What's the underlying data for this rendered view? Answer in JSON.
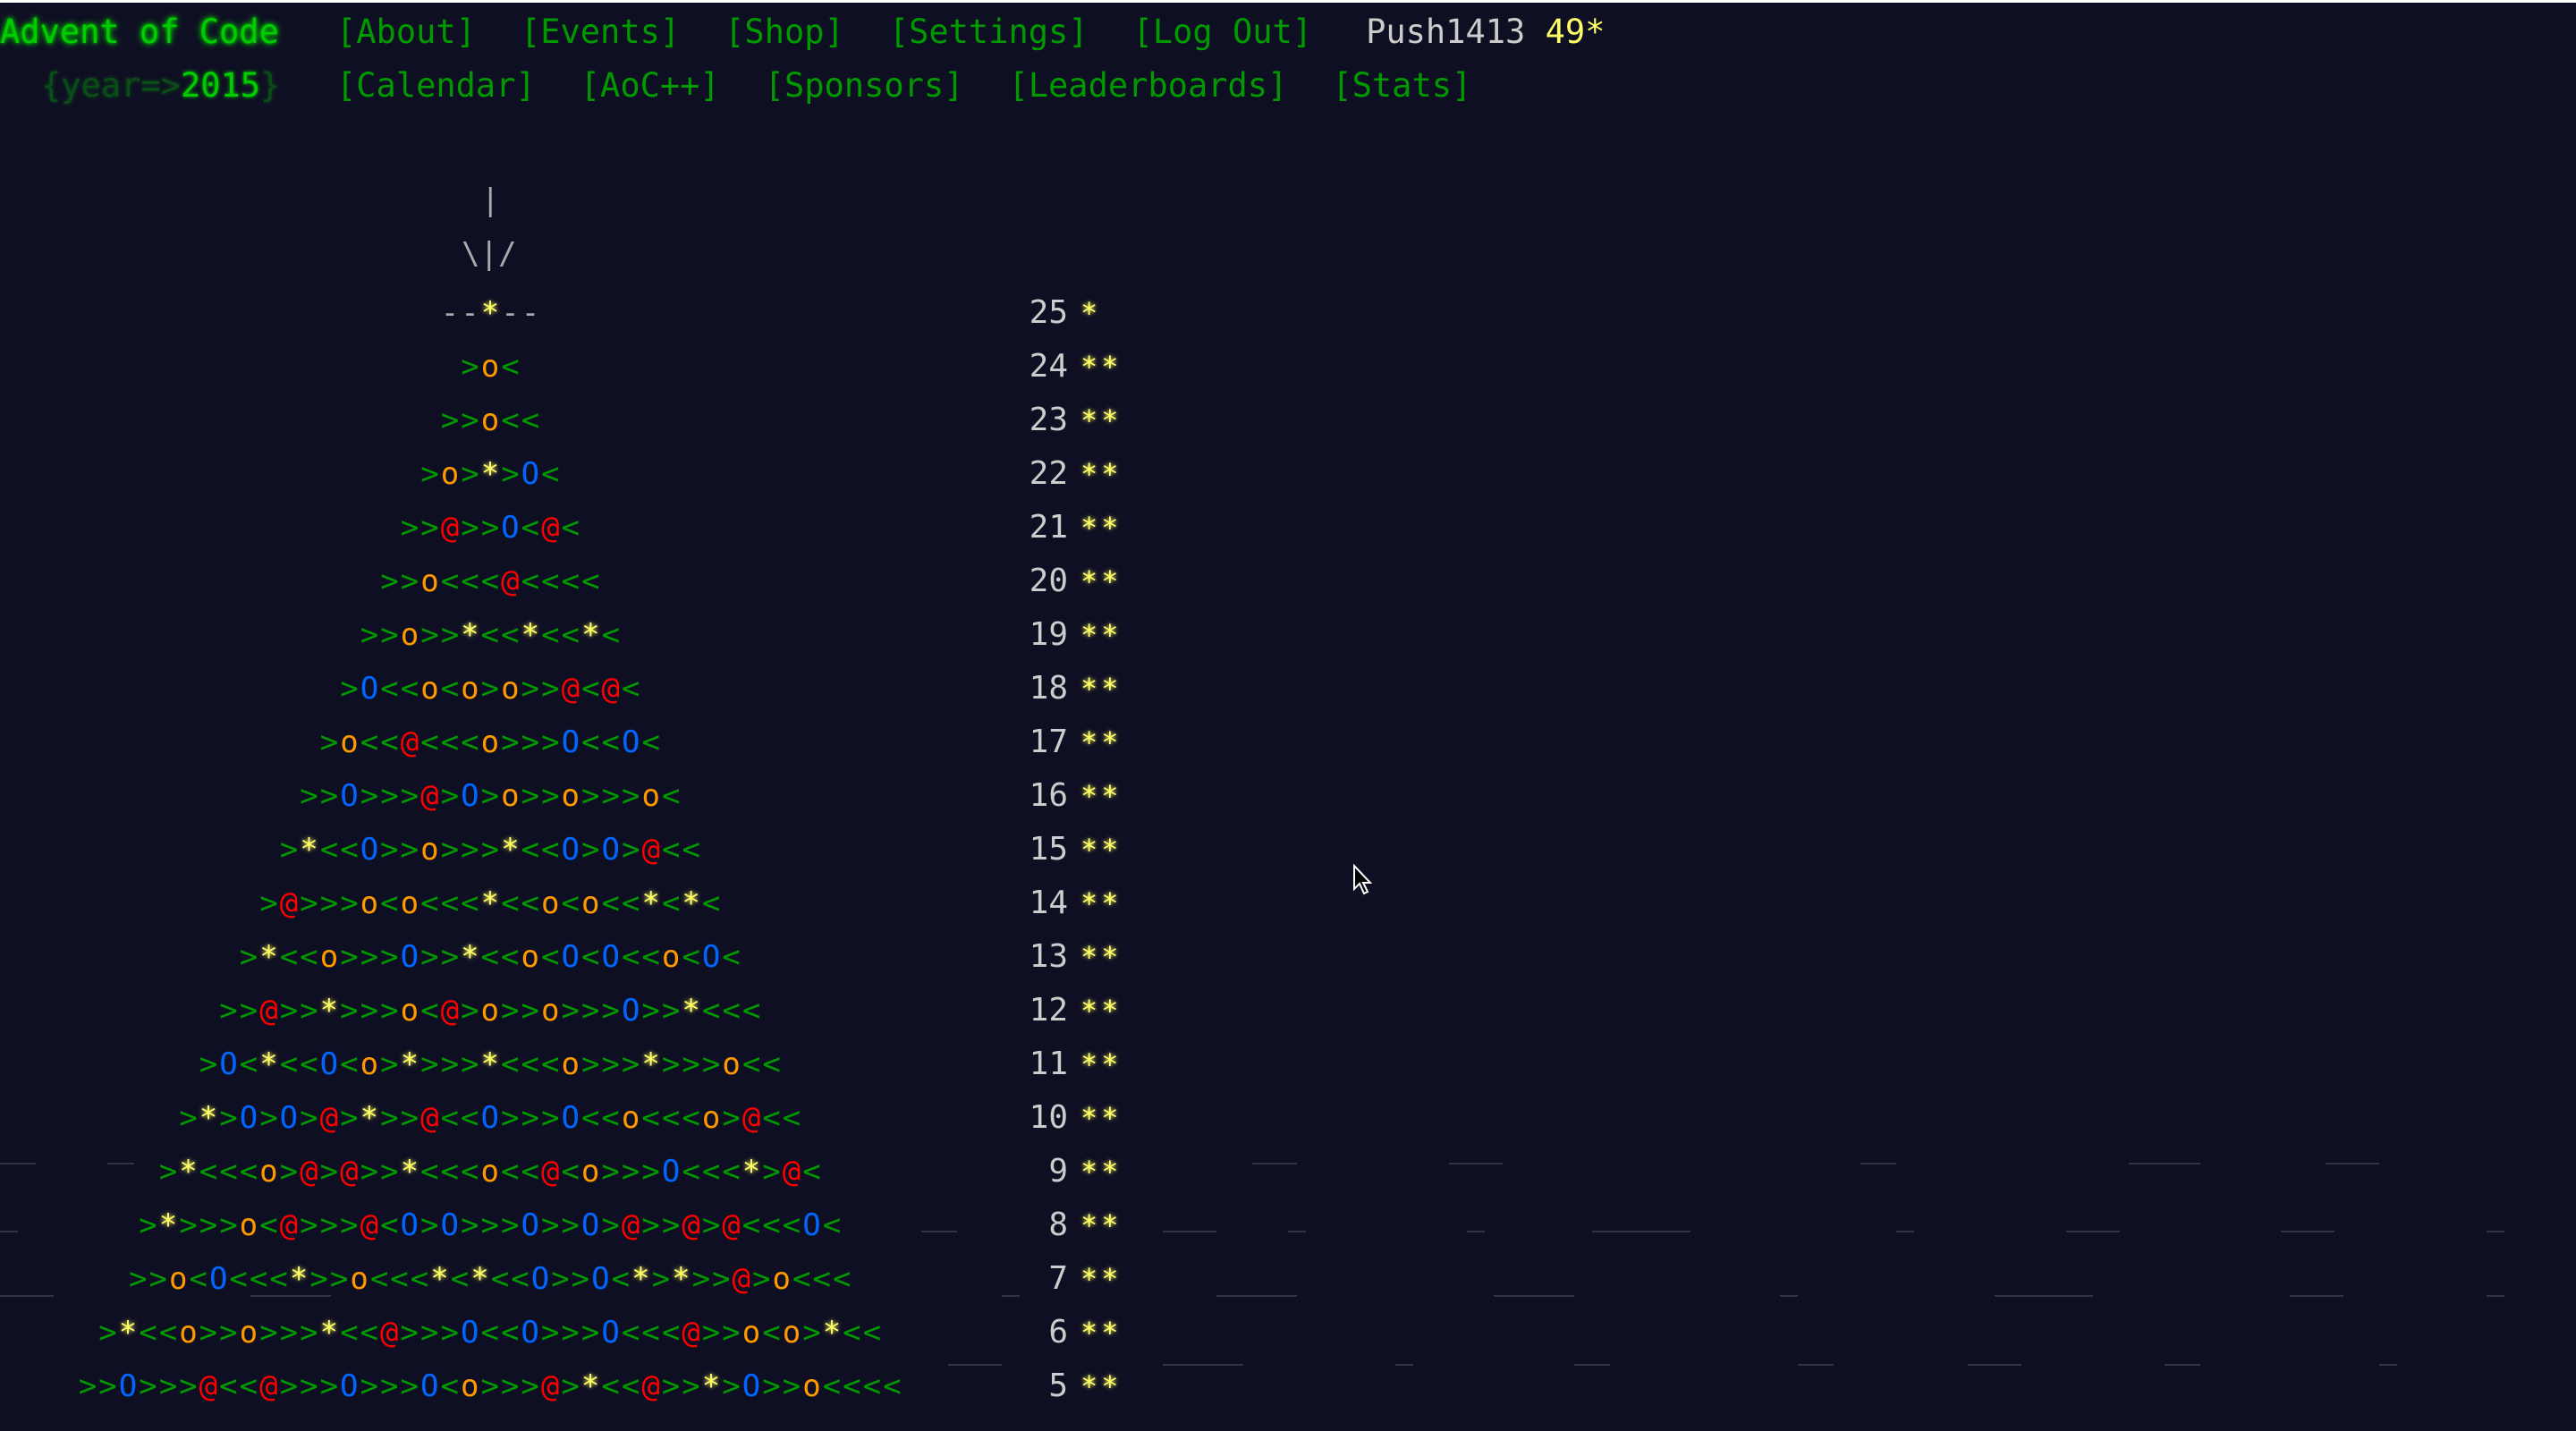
{
  "header": {
    "logo": "Advent of Code",
    "year_prefix": "{year=>",
    "year": "2015",
    "year_suffix": "}",
    "nav_row1": [
      "[About]",
      "[Events]",
      "[Shop]",
      "[Settings]",
      "[Log Out]"
    ],
    "user": "Push1413",
    "user_stars": "49*",
    "nav_row2": [
      "[Calendar]",
      "[AoC++]",
      "[Sponsors]",
      "[Leaderboards]",
      "[Stats]"
    ]
  },
  "calendar": {
    "trunk": [
      "|",
      "\\|/"
    ],
    "days": [
      {
        "day": "25",
        "stars": "*"
      },
      {
        "day": "24",
        "stars": "**"
      },
      {
        "day": "23",
        "stars": "**"
      },
      {
        "day": "22",
        "stars": "**"
      },
      {
        "day": "21",
        "stars": "**"
      },
      {
        "day": "20",
        "stars": "**"
      },
      {
        "day": "19",
        "stars": "**"
      },
      {
        "day": "18",
        "stars": "**"
      },
      {
        "day": "17",
        "stars": "**"
      },
      {
        "day": "16",
        "stars": "**"
      },
      {
        "day": "15",
        "stars": "**"
      },
      {
        "day": "14",
        "stars": "**"
      },
      {
        "day": "13",
        "stars": "**"
      },
      {
        "day": "12",
        "stars": "**"
      },
      {
        "day": "11",
        "stars": "**"
      },
      {
        "day": "10",
        "stars": "**"
      },
      {
        "day": "9",
        "stars": "**"
      },
      {
        "day": "8",
        "stars": "**"
      },
      {
        "day": "7",
        "stars": "**"
      },
      {
        "day": "6",
        "stars": "**"
      },
      {
        "day": "5",
        "stars": "**"
      }
    ],
    "tree_rows": [
      "--*--",
      ">o<",
      ">>o<<",
      ">o>*>O<",
      ">>@>>O<@<",
      ">>o<<<@<<<<",
      ">>o>>*<<*<<*<",
      ">O<<o<o>o>>@<@<",
      ">o<<@<<<o>>>O<<O<",
      ">>O>>>@>O>o>>o>>>o<",
      ">*<<O>>o>>>*<<O>O>@<<",
      ">@>>>o<o<<<*<<o<o<<*<*<",
      ">*<<o>>>O>>*<<o<O<O<<o<O<",
      ">>@>>*>>>o<@>o>>o>>>O>>*<<<",
      ">O<*<<O<o>*>>>*<<<o>>>*>>>o<<",
      ">*>O>O>@>*>>@<<O>>>O<<o<<<o>@<<",
      ">*<<<o>@>@>>*<<<o<<@<o>>>O<<<*>@<",
      ">*>>>o<@>>>@<O>O>>>O>>O>@>>@>@<<<O<",
      ">>o<O<<<*>>o<<<*<*<<O>>O<*>*>>@>o<<<",
      ">*<<o>>o>>>*<<@>>>O<<O>>>O<<<@>>o<o>*<<",
      ">>O>>>@<<@>>>O>>>O<o>>>@>*<<@>>*>O>>o<<<<"
    ]
  }
}
